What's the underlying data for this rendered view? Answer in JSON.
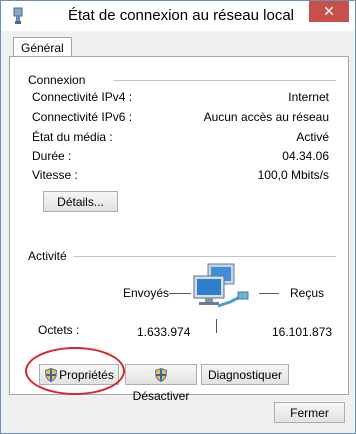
{
  "window": {
    "title": "État de connexion au réseau local",
    "close_glyph": "✕"
  },
  "tabs": [
    {
      "label": "Général"
    }
  ],
  "connection": {
    "heading": "Connexion",
    "rows": [
      {
        "label": "Connectivité IPv4 :",
        "value": "Internet"
      },
      {
        "label": "Connectivité IPv6 :",
        "value": "Aucun accès au réseau"
      },
      {
        "label": "État du média :",
        "value": "Activé"
      },
      {
        "label": "Durée :",
        "value": "04.34.06"
      },
      {
        "label": "Vitesse :",
        "value": "100,0 Mbits/s"
      }
    ],
    "details_label": "Détails..."
  },
  "activity": {
    "heading": "Activité",
    "sent_label": "Envoyés",
    "received_label": "Reçus",
    "bytes_label": "Octets :",
    "bytes_sent": "1.633.974",
    "bytes_received": "16.101.873",
    "icon": "network-computers-icon"
  },
  "buttons": {
    "properties": "Propriétés",
    "disable": "Désactiver",
    "diagnose": "Diagnostiquer",
    "close": "Fermer"
  },
  "colors": {
    "highlight": "#d6262c",
    "close_button": "#c7504a",
    "border": "#6d8fb5"
  }
}
